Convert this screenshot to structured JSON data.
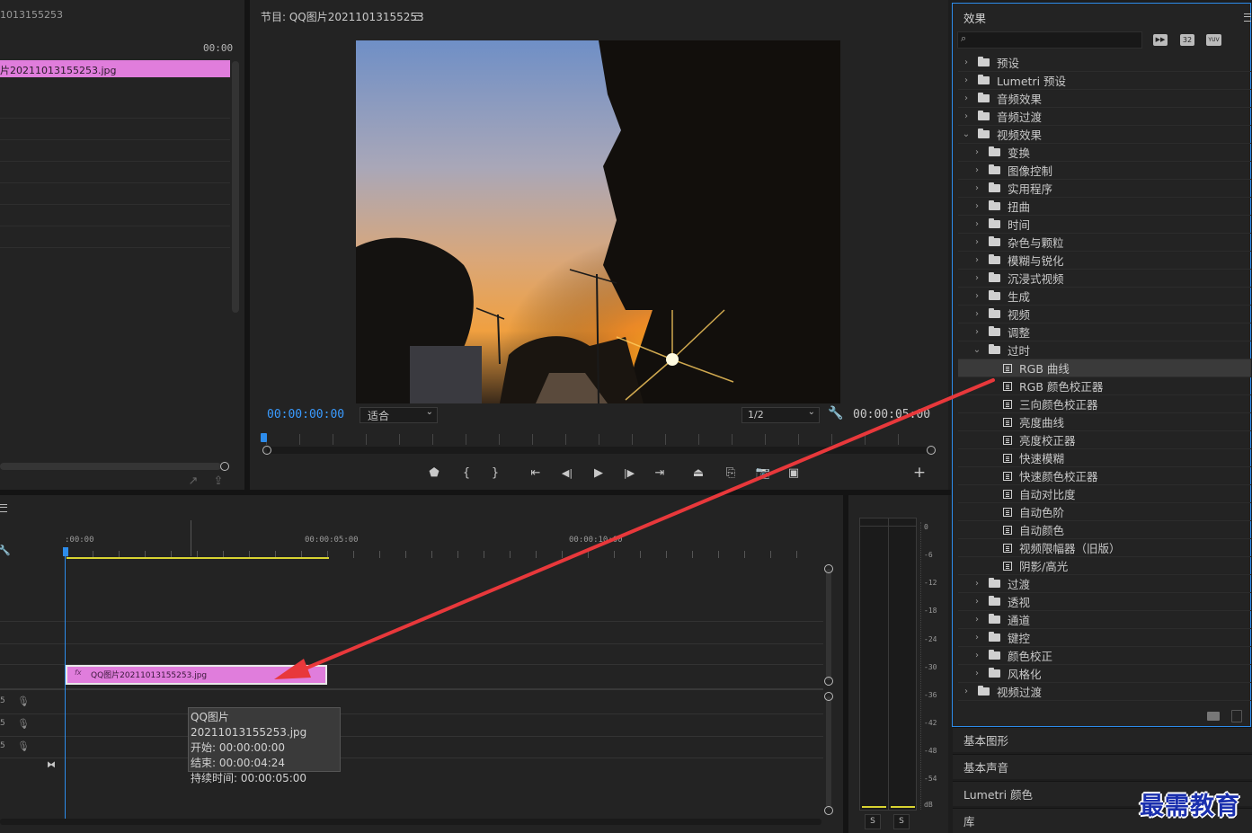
{
  "source_panel": {
    "clip_name": "片20211013155253.jpg",
    "header_fragment": "1013155253",
    "timecode": "00:00"
  },
  "program_monitor": {
    "title": "节目: QQ图片20211013155253",
    "menu_icon": "hamburger-icon",
    "timecode_current": "00:00:00:00",
    "fit_select": "适合",
    "resolution_select": "1/2",
    "timecode_duration": "00:00:05:00",
    "playhead_fraction": 0.0,
    "controls": [
      "marker-icon",
      "mark-in-icon",
      "mark-out-icon",
      "go-to-in-icon",
      "step-back-icon",
      "play-icon",
      "step-forward-icon",
      "go-to-out-icon",
      "lift-icon",
      "extract-icon",
      "export-frame-icon",
      "compare-icon",
      "add-icon"
    ]
  },
  "timeline": {
    "menu_icon": "hamburger-icon",
    "ruler_labels": [
      ":00:00",
      "00:00:05:00",
      "00:00:10:00"
    ],
    "clip_label": "QQ图片20211013155253.jpg",
    "clip_fx": "fx",
    "track_letters": [
      "S",
      "S",
      "S"
    ],
    "tooltip": {
      "title": "QQ图片20211013155253.jpg",
      "start": "开始: 00:00:00:00",
      "end": "结束: 00:00:04:24",
      "duration": "持续时间: 00:00:05:00"
    }
  },
  "audio_meter": {
    "scale": [
      "0",
      "-6",
      "-12",
      "-18",
      "-24",
      "-30",
      "-36",
      "-42",
      "-48",
      "-54",
      "dB"
    ],
    "solo_buttons": [
      "S",
      "S"
    ]
  },
  "effects_panel": {
    "title": "效果",
    "menu_icon": "hamburger-icon",
    "search_placeholder": "",
    "filter_icons": [
      "accelerated-effects-icon",
      "32-bit-icon",
      "yuv-icon"
    ],
    "tree": [
      {
        "label": "预设",
        "level": 0,
        "type": "special-folder",
        "expanded": false
      },
      {
        "label": "Lumetri 预设",
        "level": 0,
        "type": "special-folder",
        "expanded": false
      },
      {
        "label": "音频效果",
        "level": 0,
        "type": "folder",
        "expanded": false
      },
      {
        "label": "音频过渡",
        "level": 0,
        "type": "folder",
        "expanded": false
      },
      {
        "label": "视频效果",
        "level": 0,
        "type": "folder",
        "expanded": true
      },
      {
        "label": "变换",
        "level": 1,
        "type": "folder",
        "expanded": false
      },
      {
        "label": "图像控制",
        "level": 1,
        "type": "folder",
        "expanded": false
      },
      {
        "label": "实用程序",
        "level": 1,
        "type": "folder",
        "expanded": false
      },
      {
        "label": "扭曲",
        "level": 1,
        "type": "folder",
        "expanded": false
      },
      {
        "label": "时间",
        "level": 1,
        "type": "folder",
        "expanded": false
      },
      {
        "label": "杂色与颗粒",
        "level": 1,
        "type": "folder",
        "expanded": false
      },
      {
        "label": "模糊与锐化",
        "level": 1,
        "type": "folder",
        "expanded": false
      },
      {
        "label": "沉浸式视频",
        "level": 1,
        "type": "folder",
        "expanded": false
      },
      {
        "label": "生成",
        "level": 1,
        "type": "folder",
        "expanded": false
      },
      {
        "label": "视频",
        "level": 1,
        "type": "folder",
        "expanded": false
      },
      {
        "label": "调整",
        "level": 1,
        "type": "folder",
        "expanded": false
      },
      {
        "label": "过时",
        "level": 1,
        "type": "folder",
        "expanded": true
      },
      {
        "label": "RGB 曲线",
        "level": 2,
        "type": "effect",
        "selected": true
      },
      {
        "label": "RGB 颜色校正器",
        "level": 2,
        "type": "effect"
      },
      {
        "label": "三向颜色校正器",
        "level": 2,
        "type": "effect"
      },
      {
        "label": "亮度曲线",
        "level": 2,
        "type": "effect"
      },
      {
        "label": "亮度校正器",
        "level": 2,
        "type": "effect"
      },
      {
        "label": "快速模糊",
        "level": 2,
        "type": "effect"
      },
      {
        "label": "快速颜色校正器",
        "level": 2,
        "type": "effect"
      },
      {
        "label": "自动对比度",
        "level": 2,
        "type": "effect"
      },
      {
        "label": "自动色阶",
        "level": 2,
        "type": "effect"
      },
      {
        "label": "自动颜色",
        "level": 2,
        "type": "effect"
      },
      {
        "label": "视频限幅器（旧版）",
        "level": 2,
        "type": "effect"
      },
      {
        "label": "阴影/高光",
        "level": 2,
        "type": "effect"
      },
      {
        "label": "过渡",
        "level": 1,
        "type": "folder",
        "expanded": false
      },
      {
        "label": "透视",
        "level": 1,
        "type": "folder",
        "expanded": false
      },
      {
        "label": "通道",
        "level": 1,
        "type": "folder",
        "expanded": false
      },
      {
        "label": "键控",
        "level": 1,
        "type": "folder",
        "expanded": false
      },
      {
        "label": "颜色校正",
        "level": 1,
        "type": "folder",
        "expanded": false
      },
      {
        "label": "风格化",
        "level": 1,
        "type": "folder",
        "expanded": false
      },
      {
        "label": "视频过渡",
        "level": 0,
        "type": "folder",
        "expanded": false
      }
    ],
    "bottom_tabs": [
      "基本图形",
      "基本声音",
      "Lumetri 颜色",
      "库"
    ]
  },
  "watermark": "最需教育",
  "colors": {
    "accent_blue": "#2d8ceb",
    "clip_pink": "#e07ddc",
    "arrow_red": "#e8383b",
    "work_area_yellow": "#d8d331"
  }
}
